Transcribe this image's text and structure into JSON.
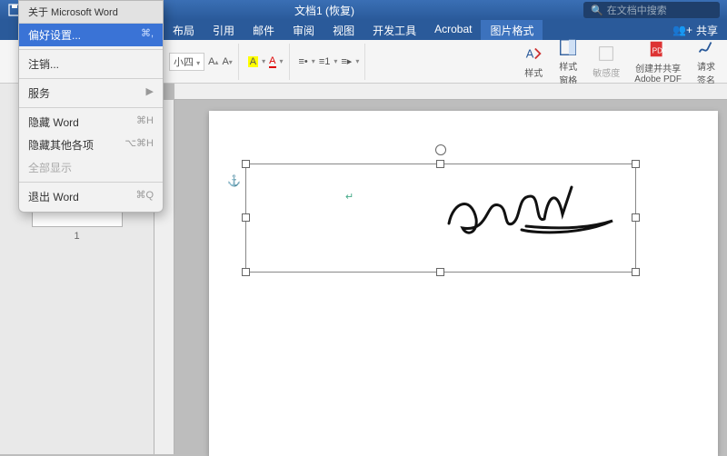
{
  "titlebar": {
    "doc_title": "文档1 (恢复)",
    "search_placeholder": "在文档中搜索"
  },
  "tabs": {
    "items": [
      "布局",
      "引用",
      "邮件",
      "审阅",
      "视图",
      "开发工具",
      "Acrobat",
      "图片格式"
    ],
    "active_index": 7,
    "share_label": "共享"
  },
  "ribbon": {
    "font_size": "小四",
    "style_label": "样式",
    "style_pane_label": "样式\n窗格",
    "sensitivity_label": "敏感度",
    "adobe_label": "创建并共享\nAdobe PDF",
    "sign_label": "请求\n签名"
  },
  "thumbs": {
    "page_num": "1"
  },
  "app_menu": {
    "title": "关于 Microsoft Word",
    "items": [
      {
        "label": "偏好设置...",
        "shortcut": "⌘,",
        "highlighted": true
      },
      {
        "sep": true
      },
      {
        "label": "注销..."
      },
      {
        "sep": true
      },
      {
        "label": "服务",
        "submenu": true
      },
      {
        "sep": true
      },
      {
        "label": "隐藏 Word",
        "shortcut": "⌘H"
      },
      {
        "label": "隐藏其他各项",
        "shortcut": "⌥⌘H"
      },
      {
        "label": "全部显示",
        "disabled": true
      },
      {
        "sep": true
      },
      {
        "label": "退出 Word",
        "shortcut": "⌘Q"
      }
    ]
  }
}
